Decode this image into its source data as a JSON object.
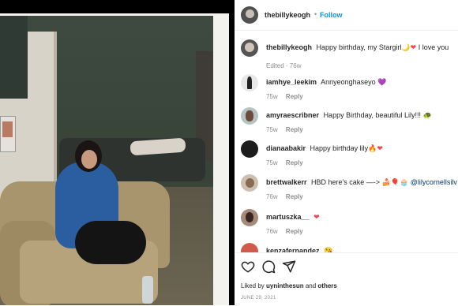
{
  "post": {
    "username": "thebillykeogh",
    "follow_label": "Follow",
    "separator": "•"
  },
  "caption": {
    "username": "thebillykeogh",
    "text": "Happy birthday, my Stargirl🌙",
    "text_tail": "I love you",
    "meta": "Edited · 76w"
  },
  "comments": [
    {
      "username": "iamhye_leekim",
      "text": "Annyeonghaseyo",
      "emoji_tail": "💜",
      "age": "75w",
      "reply": "Reply"
    },
    {
      "username": "amyraescribner",
      "text": "Happy Birthday, beautiful Lily!!!",
      "emoji_tail": "🐢",
      "age": "75w",
      "reply": "Reply"
    },
    {
      "username": "dianaabakir",
      "text": "Happy birthday lily",
      "emoji_tail": "🔥",
      "age": "75w",
      "reply": "Reply"
    },
    {
      "username": "brettwalkerr",
      "text": "HBD here's cake —-> 🍰🎈🧁",
      "mention": "@lilycornellsilv",
      "age": "76w",
      "reply": "Reply"
    },
    {
      "username": "martuszka__",
      "text": "",
      "age": "76w",
      "reply": "Reply"
    },
    {
      "username": "kenzafernandez",
      "text": "😘",
      "age": "",
      "reply": ""
    }
  ],
  "likes": {
    "prefix": "Liked by",
    "user": "uyninthesun",
    "joiner": "and",
    "others": "others"
  },
  "date": "JUNE 29, 2021",
  "icons": {
    "like": "heart-outline-icon",
    "comment": "comment-bubble-icon",
    "share": "paper-plane-icon"
  },
  "colors": {
    "follow": "#0095f6",
    "heart": "#ed4956",
    "muted": "#8e8e8e"
  }
}
